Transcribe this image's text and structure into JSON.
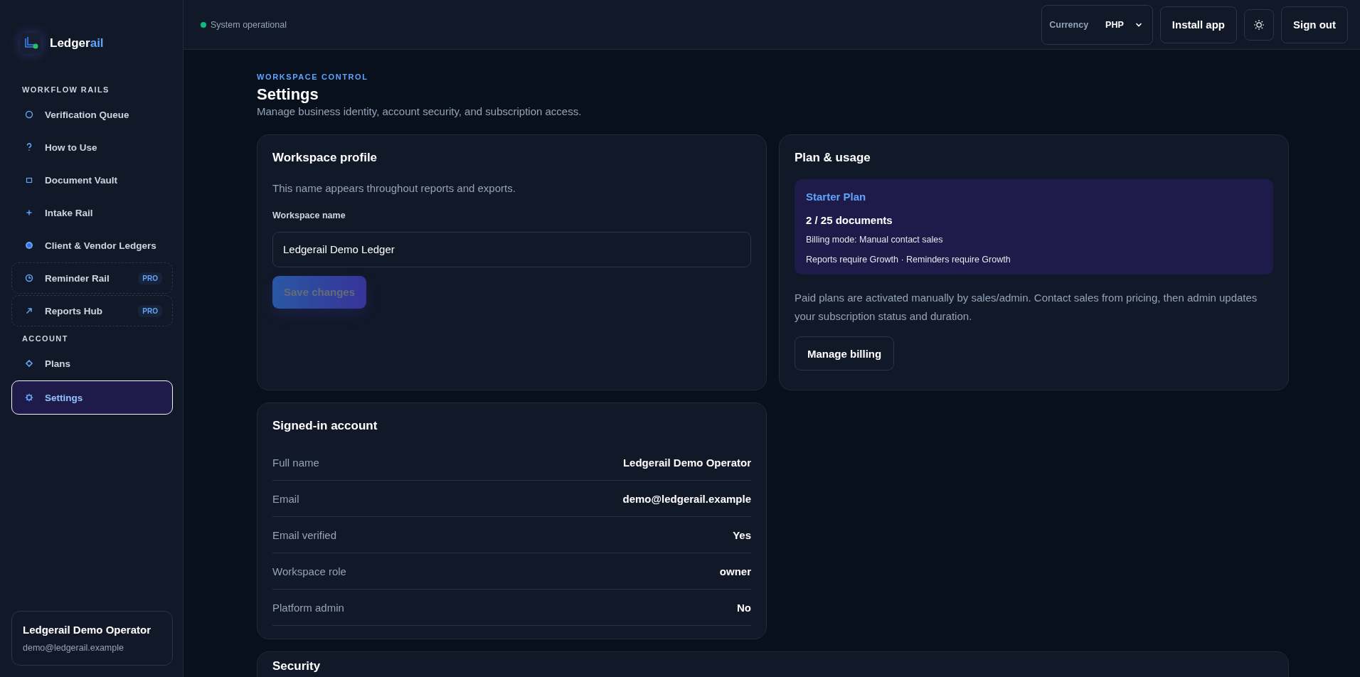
{
  "brand": {
    "name_main": "Ledger",
    "name_accent": "ail"
  },
  "sidebar": {
    "sections": [
      {
        "label": "WORKFLOW RAILS",
        "items": [
          {
            "label": "Verification Queue",
            "selected": false,
            "locked": false
          },
          {
            "label": "How to Use",
            "selected": false,
            "locked": false
          },
          {
            "label": "Document Vault",
            "selected": false,
            "locked": false
          },
          {
            "label": "Intake Rail",
            "selected": false,
            "locked": false
          },
          {
            "label": "Client & Vendor Ledgers",
            "selected": false,
            "locked": false
          },
          {
            "label": "Reminder Rail",
            "selected": false,
            "locked": true,
            "badge": "PRO"
          },
          {
            "label": "Reports Hub",
            "selected": false,
            "locked": true,
            "badge": "PRO"
          }
        ]
      },
      {
        "label": "ACCOUNT",
        "items": [
          {
            "label": "Plans",
            "selected": false,
            "locked": false
          },
          {
            "label": "Settings",
            "selected": true,
            "locked": false
          }
        ]
      }
    ],
    "user": {
      "name": "Ledgerail Demo Operator",
      "email": "demo@ledgerail.example"
    }
  },
  "topbar": {
    "status": "System operational",
    "currency_label": "Currency",
    "currency_value": "PHP",
    "buttons": [
      "Install app",
      "Sign out"
    ]
  },
  "page": {
    "eyebrow": "WORKSPACE CONTROL",
    "title": "Settings",
    "subtitle": "Manage business identity, account security, and subscription access."
  },
  "profile_card": {
    "title": "Workspace profile",
    "description": "This name appears throughout reports and exports.",
    "field_label": "Workspace name",
    "field_value": "Ledgerail Demo Ledger",
    "save_button": {
      "label": "Save changes",
      "disabled": true
    }
  },
  "plan_card": {
    "title": "Plan & usage",
    "plan_name": "Starter Plan",
    "usage": "2 / 25 documents",
    "billing_mode": "Billing mode: Manual contact sales",
    "requirements": "Reports require Growth · Reminders require Growth",
    "note": "Paid plans are activated manually by sales/admin. Contact sales from pricing, then admin updates your subscription status and duration.",
    "button": "Manage billing"
  },
  "account_card": {
    "title": "Signed-in account",
    "rows": [
      {
        "label": "Full name",
        "value": "Ledgerail Demo Operator"
      },
      {
        "label": "Email",
        "value": "demo@ledgerail.example"
      },
      {
        "label": "Email verified",
        "value": "Yes"
      },
      {
        "label": "Workspace role",
        "value": "owner"
      },
      {
        "label": "Platform admin",
        "value": "No"
      }
    ]
  },
  "security_card": {
    "title": "Security"
  }
}
